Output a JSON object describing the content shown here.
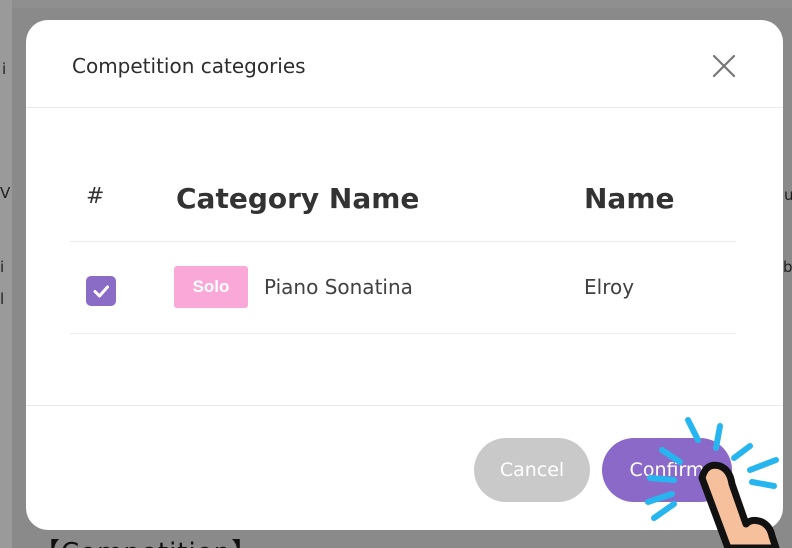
{
  "background": {
    "fragments": [
      "i",
      "V",
      "i",
      "l",
      "b",
      "u"
    ],
    "page_title": "【Competition】"
  },
  "modal": {
    "title": "Competition categories",
    "close_icon": "close-icon",
    "table": {
      "headers": {
        "index": "#",
        "category_name": "Category Name",
        "name": "Name"
      },
      "rows": [
        {
          "checked": true,
          "tag": "Solo",
          "category_name": "Piano Sonatina",
          "name": "Elroy"
        }
      ]
    },
    "footer": {
      "cancel_label": "Cancel",
      "confirm_label": "Confirm"
    }
  },
  "colors": {
    "accent": "#8b69c8",
    "tag_pink": "#f9a8d7",
    "cancel_gray": "#c9c9c9",
    "tap_burst": "#27b5f0"
  },
  "overlay_icon": "tap-hand-icon"
}
